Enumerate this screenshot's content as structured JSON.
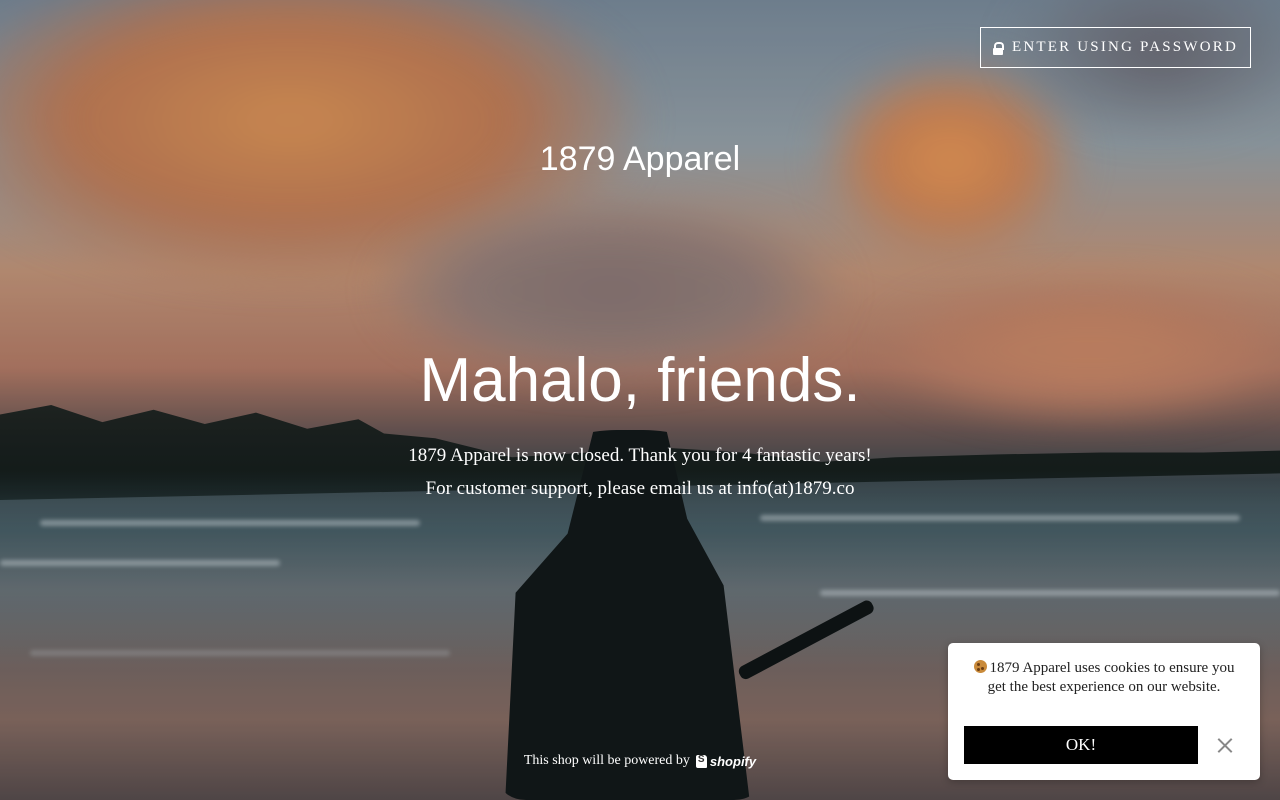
{
  "header": {
    "password_button_label": "ENTER USING PASSWORD",
    "password_icon": "lock-icon"
  },
  "store": {
    "name": "1879 Apparel"
  },
  "main": {
    "headline": "Mahalo, friends.",
    "message": "1879 Apparel is now closed. Thank you for 4 fantastic years! For customer support, please email us at info(at)1879.co"
  },
  "footer": {
    "powered_text": "This shop will be powered by",
    "shopify_label": "shopify",
    "shopify_icon": "shopify-bag-icon"
  },
  "cookie_banner": {
    "icon": "cookie-icon",
    "text": "1879 Apparel uses cookies to ensure you get the best experience on our website.",
    "ok_label": "OK!",
    "close_icon": "close-icon"
  },
  "colors": {
    "button_bg": "#000000",
    "banner_bg": "#ffffff",
    "text": "#ffffff"
  }
}
